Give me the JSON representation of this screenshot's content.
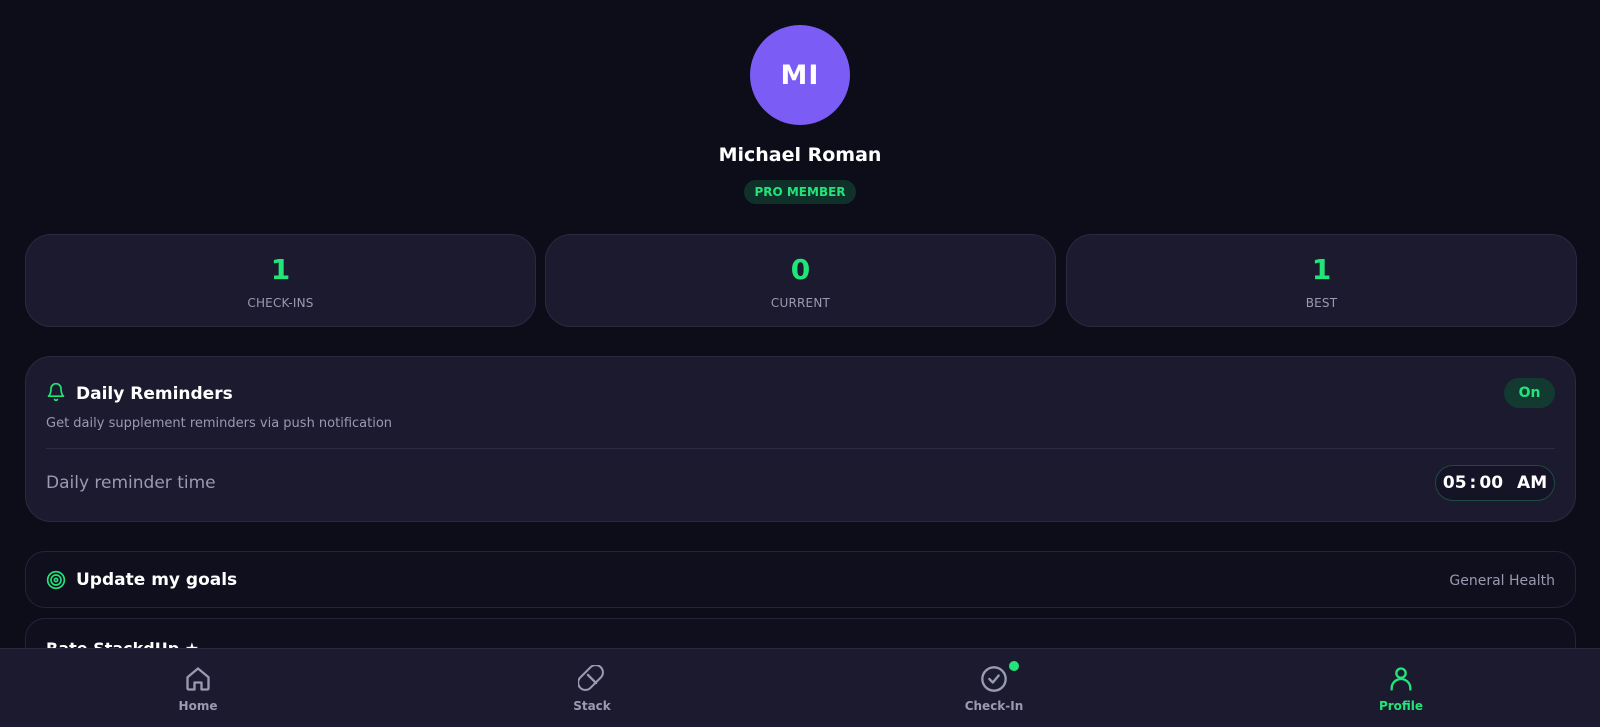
{
  "profile": {
    "initials": "MI",
    "name": "Michael Roman",
    "badge": "PRO MEMBER"
  },
  "stats": [
    {
      "value": "1",
      "label": "CHECK-INS"
    },
    {
      "value": "0",
      "label": "CURRENT"
    },
    {
      "value": "1",
      "label": "BEST"
    }
  ],
  "reminders": {
    "title": "Daily Reminders",
    "subtitle": "Get daily supplement reminders via push notification",
    "toggle_label": "On",
    "time_label": "Daily reminder time",
    "time_hour": "05",
    "time_separator": ":",
    "time_minute": "00",
    "time_period": "AM"
  },
  "goals": {
    "title": "Update my goals",
    "value": "General Health"
  },
  "rate": {
    "title": "Rate StackdUp ★"
  },
  "nav": {
    "items": [
      {
        "label": "Home",
        "icon": "home-icon"
      },
      {
        "label": "Stack",
        "icon": "pill-icon"
      },
      {
        "label": "Check-In",
        "icon": "check-circle-icon"
      },
      {
        "label": "Profile",
        "icon": "user-icon"
      }
    ],
    "active": "Profile"
  },
  "colors": {
    "background": "#0d0d1a",
    "card": "#1b1a2e",
    "accent": "#22e57a",
    "avatar": "#7b5cf5",
    "muted_text": "#9a9ab0"
  }
}
